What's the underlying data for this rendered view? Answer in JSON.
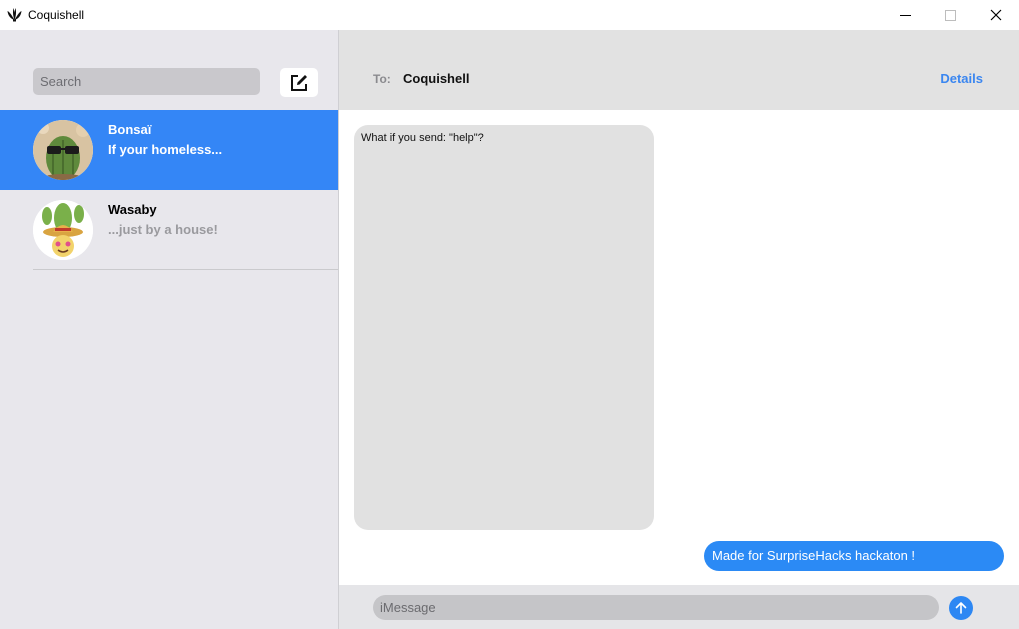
{
  "window": {
    "title": "Coquishell",
    "icons": {
      "app": "coquishell-shell-icon",
      "minimize": "minimize-icon",
      "maximize": "maximize-icon",
      "close": "close-icon"
    }
  },
  "sidebar": {
    "search_placeholder": "Search",
    "compose_icon": "compose-icon",
    "conversations": [
      {
        "name": "Bonsaï",
        "preview": "If your homeless...",
        "active": true,
        "avatar": "cactus-with-sunglasses-avatar"
      },
      {
        "name": "Wasaby",
        "preview": "...just by a house!",
        "active": false,
        "avatar": "cactus-with-sombrero-avatar"
      }
    ]
  },
  "header": {
    "to_label": "To:",
    "recipient": "Coquishell",
    "details_label": "Details"
  },
  "messages": [
    {
      "direction": "incoming",
      "text": "What if you send: \"help\"?"
    },
    {
      "direction": "outgoing",
      "text": "Made for SurpriseHacks hackaton !"
    }
  ],
  "composer": {
    "placeholder": "iMessage",
    "send_icon": "send-arrow-icon"
  },
  "colors": {
    "accent": "#3486f6",
    "sidebar_bg": "#e8e7ec",
    "header_bg": "#e2e2e2",
    "incoming_bubble": "#e1e1e1",
    "outgoing_bubble": "#2b8af5"
  }
}
